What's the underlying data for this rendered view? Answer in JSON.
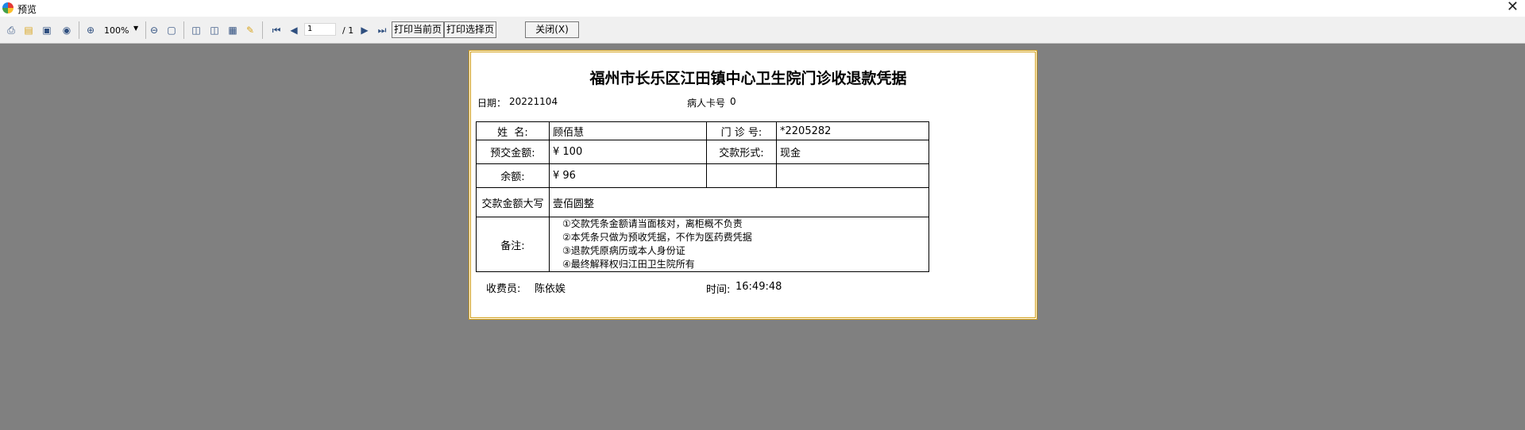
{
  "window": {
    "title": "预览",
    "close_glyph": "✕"
  },
  "toolbar": {
    "icons": [
      "print-icon",
      "open-folder-icon",
      "save-icon",
      "find-icon",
      "zoom-in-icon",
      "zoom-out-icon",
      "fit-page-icon",
      "single-page-icon",
      "two-page-icon",
      "thumbnail-icon",
      "edit-icon",
      "first-page-icon",
      "prev-page-icon",
      "next-page-icon",
      "last-page-icon"
    ],
    "zoom": "100%",
    "page_input": "1",
    "page_total": "/ 1",
    "print_current_label": "打印当前页",
    "print_select_label": "打印选择页",
    "close_label": "关闭(X)"
  },
  "receipt": {
    "title": "福州市长乐区江田镇中心卫生院门诊收退款凭据",
    "date_label": "日期：",
    "date_value": "20221104",
    "card_label": "病人卡号",
    "card_value": "0",
    "rows": {
      "name_label": "姓  名:",
      "name_value": "顾佰慧",
      "clinic_no_label": "门 诊 号:",
      "clinic_no_value": "*2205282",
      "prepaid_label": "预交金额:",
      "prepaid_value": "¥ 100",
      "pay_method_label": "交款形式:",
      "pay_method_value": "现金",
      "balance_label": "余额:",
      "balance_value": "¥ 96",
      "amount_upper_label": "交款金额大写",
      "amount_upper_value": "壹佰圆整",
      "notes_label": "备注:",
      "notes": [
        "①交款凭条金额请当面核对，离柜概不负责",
        "②本凭条只做为预收凭据，不作为医药费凭据",
        "③退款凭原病历或本人身份证",
        "④最终解释权归江田卫生院所有"
      ]
    },
    "cashier_label": "收费员:",
    "cashier_value": "陈依娭",
    "time_label": "时间:",
    "time_value": "16:49:48"
  },
  "colors": {
    "background": "#808080",
    "paper_border": "#d4a017",
    "toolbar": "#f0f0f0"
  }
}
